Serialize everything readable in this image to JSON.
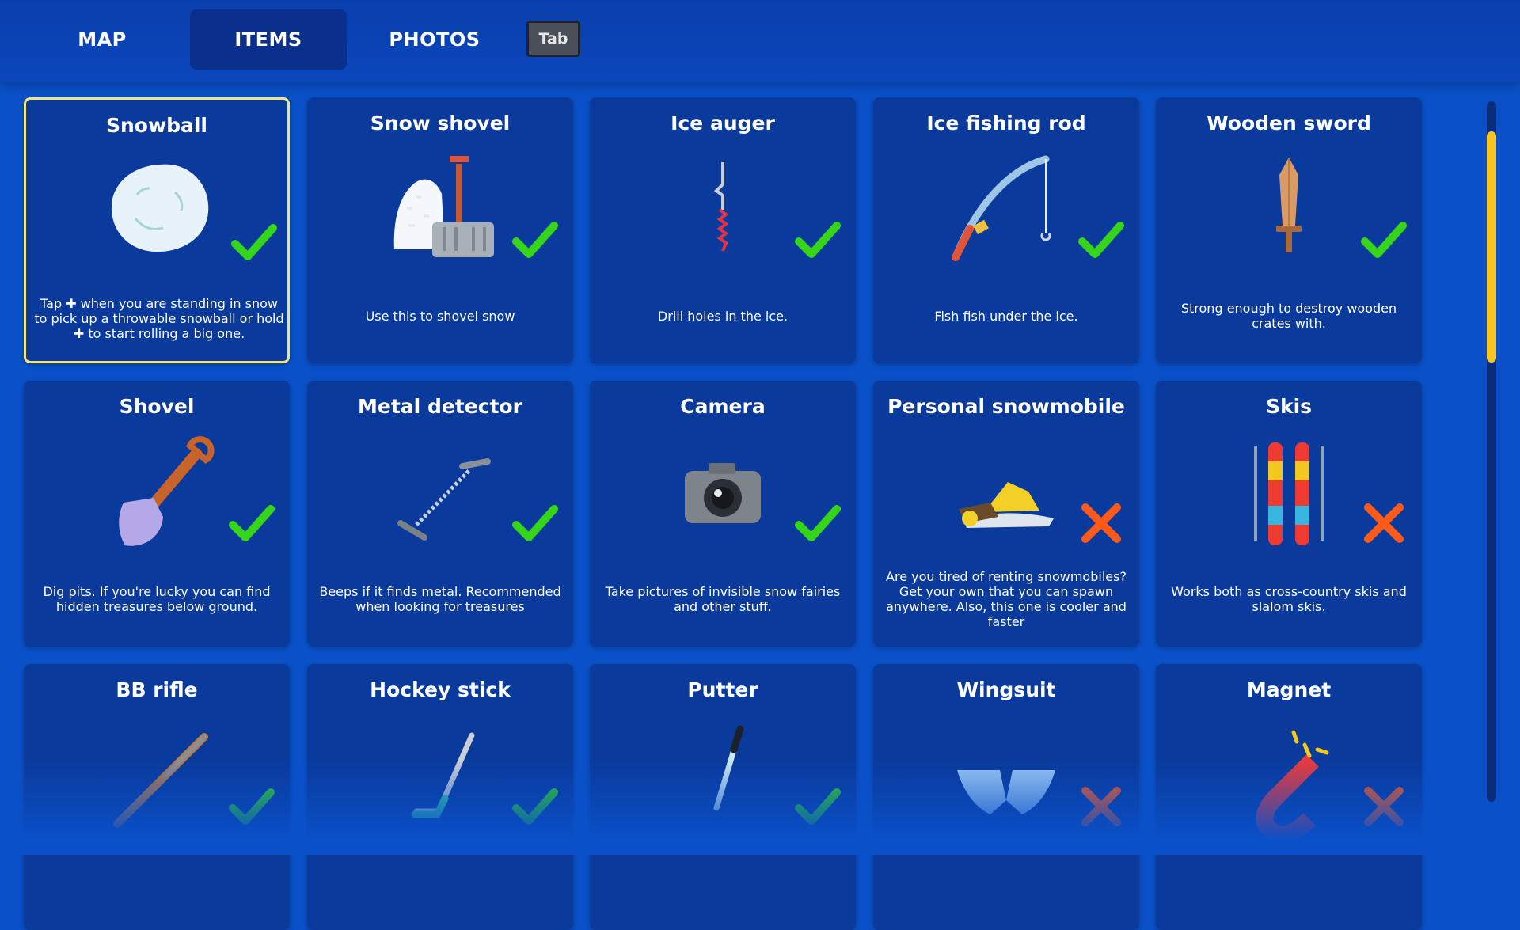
{
  "tabs": [
    {
      "label": "MAP",
      "active": false
    },
    {
      "label": "ITEMS",
      "active": true
    },
    {
      "label": "PHOTOS",
      "active": false
    }
  ],
  "tab_key": "Tab",
  "colors": {
    "background": "#0a50c8",
    "card": "#0a3a9c",
    "selected_border": "#f2e47a",
    "owned_check": "#35d61a",
    "not_owned_x": "#ff5a1a",
    "scroll_thumb": "#f6c51f"
  },
  "items": [
    {
      "title": "Snowball",
      "desc": "Tap ✚ when you are standing in snow to pick up a throwable snowball or hold ✚ to start rolling a big one.",
      "icon": "snowball-icon",
      "owned": true,
      "selected": true
    },
    {
      "title": "Snow shovel",
      "desc": "Use this to shovel snow",
      "icon": "snow-shovel-icon",
      "owned": true
    },
    {
      "title": "Ice auger",
      "desc": "Drill holes in the ice.",
      "icon": "ice-auger-icon",
      "owned": true
    },
    {
      "title": "Ice fishing rod",
      "desc": "Fish fish under the ice.",
      "icon": "fishing-rod-icon",
      "owned": true
    },
    {
      "title": "Wooden sword",
      "desc": "Strong enough to destroy wooden crates with.",
      "icon": "sword-icon",
      "owned": true
    },
    {
      "title": "Shovel",
      "desc": "Dig pits. If you're lucky you can find hidden treasures below ground.",
      "icon": "shovel-icon",
      "owned": true
    },
    {
      "title": "Metal detector",
      "desc": "Beeps if it finds metal. Recommended when looking for treasures",
      "icon": "metal-detector-icon",
      "owned": true
    },
    {
      "title": "Camera",
      "desc": "Take pictures of invisible snow fairies and other stuff.",
      "icon": "camera-icon",
      "owned": true
    },
    {
      "title": "Personal snowmobile",
      "desc": "Are you tired of renting snowmobiles? Get your own that you can spawn anywhere. Also, this one is cooler and faster",
      "icon": "snowmobile-icon",
      "owned": false
    },
    {
      "title": "Skis",
      "desc": "Works both as cross-country skis and slalom skis.",
      "icon": "skis-icon",
      "owned": false
    },
    {
      "title": "BB rifle",
      "desc": "",
      "icon": "rifle-icon",
      "owned": true
    },
    {
      "title": "Hockey stick",
      "desc": "",
      "icon": "hockey-stick-icon",
      "owned": true
    },
    {
      "title": "Putter",
      "desc": "",
      "icon": "putter-icon",
      "owned": true
    },
    {
      "title": "Wingsuit",
      "desc": "",
      "icon": "wingsuit-icon",
      "owned": false
    },
    {
      "title": "Magnet",
      "desc": "",
      "icon": "magnet-icon",
      "owned": false
    }
  ]
}
